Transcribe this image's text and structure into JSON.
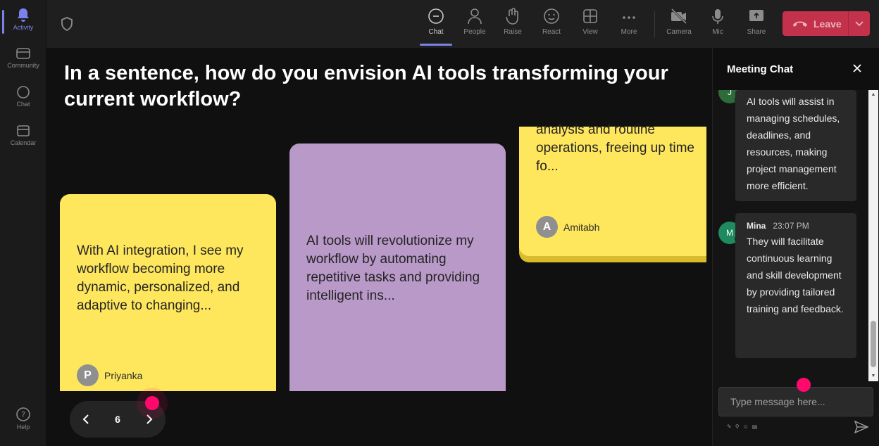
{
  "rail": {
    "items": [
      {
        "label": "Activity"
      },
      {
        "label": "Community"
      },
      {
        "label": "Chat"
      },
      {
        "label": "Calendar"
      },
      {
        "label": "Help"
      }
    ]
  },
  "toolbar": {
    "chat": "Chat",
    "people": "People",
    "raise": "Raise",
    "react": "React",
    "view": "View",
    "more": "More",
    "camera": "Camera",
    "mic": "Mic",
    "share": "Share",
    "leave": "Leave"
  },
  "stage": {
    "question": "In a sentence, how do you envision AI tools transforming your current workflow?",
    "cards": [
      {
        "text": "With AI integration, I see my workflow becoming more dynamic, personalized, and adaptive to changing...",
        "author": "Priyanka",
        "initial": "P",
        "color": "#fee75c"
      },
      {
        "text": "AI tools will revolutionize my workflow by automating repetitive tasks and providing intelligent ins...",
        "color": "#b899c8"
      },
      {
        "text": "analysis and routine operations, freeing up time fo...",
        "author": "Amitabh",
        "initial": "A",
        "color": "#fee75c"
      }
    ],
    "page": "6"
  },
  "chat": {
    "title": "Meeting Chat",
    "messages": [
      {
        "initial": "J",
        "text": "AI tools will assist in managing schedules, deadlines, and resources, making project management more efficient."
      },
      {
        "initial": "M",
        "name": "Mina",
        "time": "23:07 PM",
        "text": "They will facilitate continuous learning and skill development by providing tailored training and feedback."
      }
    ],
    "input_placeholder": "Type message here..."
  },
  "colors": {
    "accent": "#7b83eb",
    "leave": "#c4314b",
    "pointer": "#ff0a6c"
  }
}
